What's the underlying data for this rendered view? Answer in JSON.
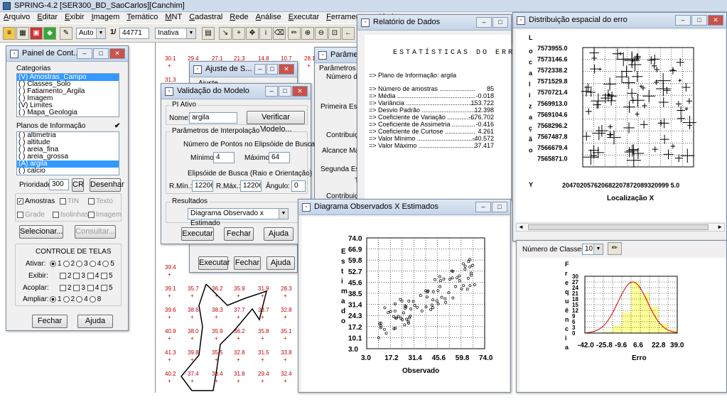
{
  "app": {
    "title": "SPRING-4.2 [SER300_BD_SaoCarlos][Canchim]",
    "behind_title": "…"
  },
  "menu": [
    "Arquivo",
    "Editar",
    "Exibir",
    "Imagem",
    "Temático",
    "MNT",
    "Cadastral",
    "Rede",
    "Análise",
    "Executar",
    "Ferramentas",
    "Ajuda"
  ],
  "toolbar": {
    "zoom_value": "Auto",
    "scale_prefix": "1/",
    "scale_value": "44771",
    "mode_value": "Inativa"
  },
  "painel": {
    "title": "Painel de Cont...",
    "categorias_label": "Categorias",
    "categorias": [
      "(V) Amostras_Campo",
      "( ) Classes_Solo",
      "( ) Fatiamento_Argila",
      "( ) Imagem",
      "(V) Limites",
      "( ) Mapa_Geologia"
    ],
    "planos_label": "Planos de Informação",
    "planos": [
      "( ) altimetria",
      "( ) altitude",
      "( ) areia_fina",
      "( ) areia_grossa",
      "(A) argila",
      "( ) calcio"
    ],
    "prioridade_label": "Prioridade:",
    "prioridade_value": "300",
    "cr_label": "CR",
    "desenhar_label": "Desenhar",
    "opts": [
      "Amostras",
      "TIN",
      "Texto",
      "Grade",
      "Isolinhas",
      "Imagem"
    ],
    "selecionar_label": "Selecionar...",
    "consultar_label": "Consultar...",
    "controle_title": "CONTROLE DE TELAS",
    "ativar_label": "Ativar:",
    "exibir_label": "Exibir:",
    "acoplar_label": "Acoplar:",
    "ampliar_label": "Ampliar:",
    "screens": [
      "1",
      "2",
      "3",
      "4",
      "5"
    ],
    "ampliar_opts": [
      "1",
      "2",
      "4",
      "8"
    ],
    "fechar_label": "Fechar",
    "ajuda_label": "Ajuda"
  },
  "ajuste": {
    "title": "Ajuste de S...",
    "sub": "Ajuste",
    "executar_label": "Executar",
    "fechar_label": "Fechar",
    "ajuda_label": "Ajuda"
  },
  "validacao": {
    "title": "Validação do Modelo",
    "pi_ativo": "PI Ativo",
    "nome_label": "Nome:",
    "nome_value": "argila",
    "verificar_label": "Verificar Modelo...",
    "param_label": "Parâmetros de Interpolação",
    "npontos_label": "Número de Pontos no Elipsóide de Busca",
    "min_label": "Mínimo:",
    "min_value": "4",
    "max_label": "Máximo:",
    "max_value": "64",
    "elip_label": "Elipsóide de Busca (Raio e Orientação)",
    "rmin_label": "R.Mín.:",
    "rmin_value": "12206.5",
    "rmax_label": "R.Máx.:",
    "rmax_value": "12206.5",
    "angulo_label": "Ângulo:",
    "angulo_value": "0",
    "resultados_label": "Resultados",
    "resultados_value": "Diagrama Observado x Estimado",
    "executar_label": "Executar",
    "fechar_label": "Fechar",
    "ajuda_label": "Ajuda"
  },
  "parametros": {
    "title": "Parâmetros",
    "lines": [
      "Parâmetros",
      "Número de",
      "Primeira Estru",
      "Contribuição",
      "Alcance Máx",
      "Segunda Estru",
      "T",
      "Contribuição"
    ]
  },
  "relatorio": {
    "title": "Relatório de Dados",
    "heading": "ESTATÍSTICAS DO ERRO",
    "plano": "=> Plano de Informação: argila",
    "rows": [
      {
        "k": "=> Número de amostras .......................",
        "v": "85"
      },
      {
        "k": "=> Média ...............................................",
        "v": "-0.018"
      },
      {
        "k": "=> Variância ..........................................",
        "v": "153.722"
      },
      {
        "k": "=> Desvio Padrão ...................................",
        "v": "12.398"
      },
      {
        "k": "=> Coeficiente de Variação ...................",
        "v": "-676.702"
      },
      {
        "k": "=> Coeficiente de Assimetria ..............",
        "v": "-0.416"
      },
      {
        "k": "=> Coeficiente de Curtose ...................",
        "v": "4.261"
      },
      {
        "k": "=> Valor Mínimo ....................................",
        "v": "-40.572"
      },
      {
        "k": "=> Valor Máximo ...................................",
        "v": "37.417"
      }
    ]
  },
  "distribuicao": {
    "title": "Distribuição espacial do erro",
    "ylabel": "Localização",
    "yticks": [
      "7573955.0",
      "7573146.6",
      "7572338.2",
      "7571529.8",
      "7570721.4",
      "7569913.0",
      "7569104.6",
      "7568296.2",
      "7567487.8",
      "7566679.4",
      "7565871.0"
    ],
    "ylabel_top": "L",
    "ylabel_bottom": "Y",
    "xticks_text": "204702057620682207872089320999 5.0",
    "xlabel": "Localização X"
  },
  "observados": {
    "title": "Diagrama Observados X Estimados",
    "yaxis_letters": [
      "E",
      "s",
      "t",
      "i",
      "m",
      "a",
      "d",
      "o"
    ],
    "ticks": [
      "74.0",
      "66.9",
      "59.8",
      "52.7",
      "45.6",
      "38.5",
      "31.4",
      "24.3",
      "17.2",
      "10.1",
      "3.0"
    ],
    "xticks": [
      "3.0",
      "17.2",
      "31.4",
      "45.6",
      "59.8",
      "74.0"
    ],
    "xlabel": "Observado"
  },
  "histograma": {
    "classes_label": "Número de Classes:",
    "classes_value": "10",
    "yaxis_letters": [
      "F",
      "r",
      "e",
      "q",
      "u",
      "ê",
      "n",
      "c",
      "i",
      "a"
    ],
    "yticks": [
      "30",
      "27",
      "24",
      "21",
      "18",
      "15",
      "12",
      "9",
      "6",
      "3",
      "0"
    ],
    "xticks": [
      "-42.0",
      "-25.8",
      "-9.6",
      "6.6",
      "22.8",
      "39.0"
    ],
    "xlabel": "Erro"
  },
  "map_values": [
    [
      "30.1",
      "29.4",
      "27.1",
      "21.3",
      "14.8",
      "10.7",
      "28.1"
    ],
    [
      "31.3",
      "",
      "",
      "",
      "",
      "",
      ""
    ],
    [
      "39.4",
      "",
      "",
      "",
      "",
      "",
      ""
    ],
    [
      "39.1",
      "35.7",
      "36.2",
      "35.9",
      "31.9",
      "28.3",
      ""
    ],
    [
      "39.6",
      "38.6",
      "38.3",
      "37.7",
      "33.7",
      "32.8",
      ""
    ],
    [
      "40.9",
      "38.0",
      "35.9",
      "36.2",
      "35.8",
      "35.1",
      ""
    ],
    [
      "41.3",
      "39.8",
      "35.5",
      "32.8",
      "31.5",
      "33.8",
      ""
    ],
    [
      "40.2",
      "37.4",
      "33.4",
      "31.8",
      "29.4",
      "32.4",
      ""
    ]
  ],
  "colors": {
    "titlebar": "#cfdcec",
    "selection": "#3399ff",
    "map_value": "#c00000",
    "hist_fill": "#ffff99",
    "curve": "#d00000"
  }
}
